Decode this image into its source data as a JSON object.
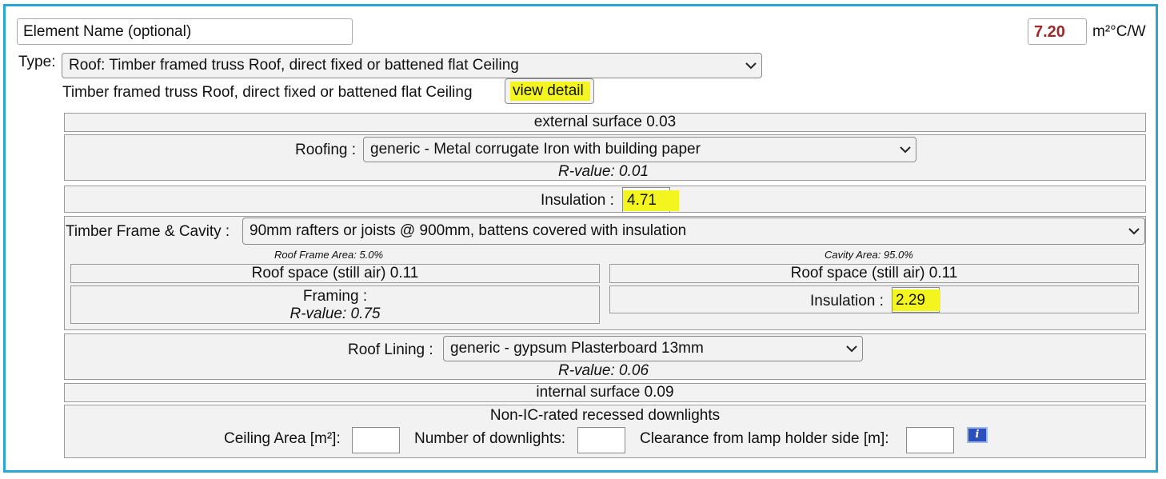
{
  "element_name_placeholder": "Element Name (optional)",
  "r_total": "7.20",
  "r_unit": "m²°C/W",
  "type_label": "Type:",
  "type_selected": "Roof: Timber framed truss Roof, direct fixed or battened flat Ceiling",
  "type_description": "Timber framed truss Roof, direct fixed or battened flat Ceiling",
  "view_detail_label": "view detail",
  "external_surface": "external surface 0.03",
  "roofing": {
    "label": "Roofing :",
    "selected": "generic - Metal corrugate Iron with building paper",
    "rvalue": "R-value: 0.01"
  },
  "insulation": {
    "label": "Insulation :",
    "value": "4.71"
  },
  "frame": {
    "label": "Timber Frame & Cavity :",
    "selected": "90mm rafters or joists @ 900mm, battens covered with insulation",
    "left": {
      "area": "Roof Frame Area: 5.0%",
      "roof_space": "Roof space (still air) 0.11",
      "framing_label": "Framing :",
      "framing_rvalue": "R-value: 0.75"
    },
    "right": {
      "area": "Cavity Area: 95.0%",
      "roof_space": "Roof space (still air) 0.11",
      "insulation_label": "Insulation :",
      "insulation_value": "2.29"
    }
  },
  "lining": {
    "label": "Roof Lining :",
    "selected": "generic - gypsum Plasterboard 13mm",
    "rvalue": "R-value: 0.06"
  },
  "internal_surface": "internal surface 0.09",
  "downlights": {
    "title": "Non-IC-rated recessed downlights",
    "ceiling_area_label": "Ceiling Area [m²]:",
    "count_label": "Number of downlights:",
    "clearance_label": "Clearance from lamp holder side [m]:",
    "info_icon": "info-icon"
  },
  "colors": {
    "frame_border": "#2aa7d0",
    "highlight": "#f4f51e",
    "r_total_text": "#9b2a2a"
  }
}
